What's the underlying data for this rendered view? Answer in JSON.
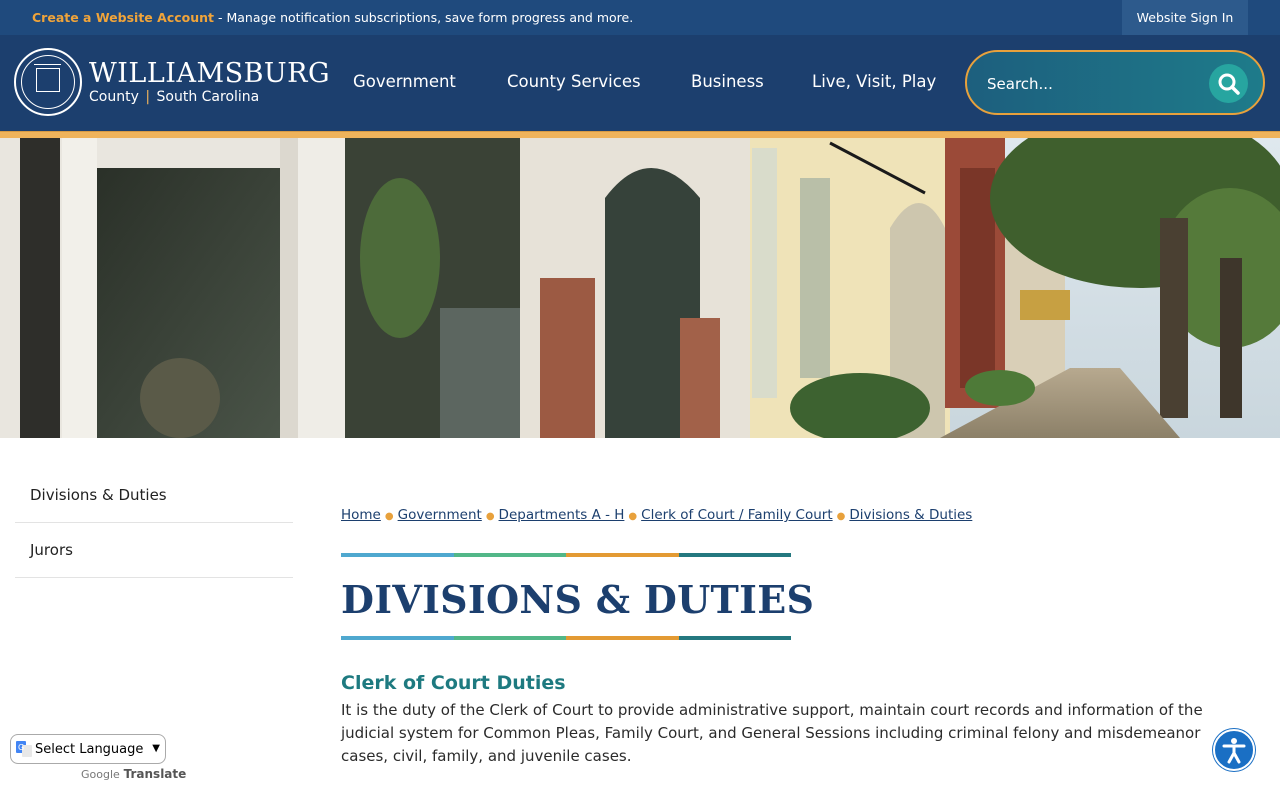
{
  "topbar": {
    "create_account": "Create a Website Account",
    "notice_text": " - Manage notification subscriptions, save form progress and more.",
    "sign_in": "Website Sign In"
  },
  "brand": {
    "name": "WILLIAMSBURG",
    "sub_county": "County",
    "sub_separator": "|",
    "sub_state": "South Carolina"
  },
  "nav": {
    "items": [
      {
        "label": "Government"
      },
      {
        "label": "County Services"
      },
      {
        "label": "Business"
      },
      {
        "label": "Live, Visit, Play"
      }
    ]
  },
  "search": {
    "placeholder": "Search...",
    "icon": "search-icon"
  },
  "hero": {
    "alt": "Historic downtown storefront street"
  },
  "sidebar": {
    "items": [
      {
        "label": "Divisions & Duties"
      },
      {
        "label": "Jurors"
      }
    ]
  },
  "breadcrumb": {
    "items": [
      {
        "label": "Home"
      },
      {
        "label": "Government"
      },
      {
        "label": "Departments A - H"
      },
      {
        "label": "Clerk of Court / Family Court"
      },
      {
        "label": "Divisions & Duties"
      }
    ]
  },
  "page": {
    "title": "DIVISIONS & DUTIES",
    "section_heading": "Clerk of Court Duties",
    "section_body": "It is the duty of the Clerk of Court to provide administrative support, maintain court records and information of the judicial system for Common Pleas, Family Court, and General Sessions including criminal felony and misdemeanor cases, civil, family, and juvenile cases."
  },
  "translate": {
    "select_label": "Select Language",
    "powered_google": "Google",
    "powered_translate": "Translate"
  },
  "colors": {
    "navy": "#1c3f6e",
    "gold": "#efb35b",
    "teal": "#1e7a80",
    "rule_segments": [
      "#4fa8cf",
      "#52b788",
      "#e39a33",
      "#24787f"
    ]
  }
}
